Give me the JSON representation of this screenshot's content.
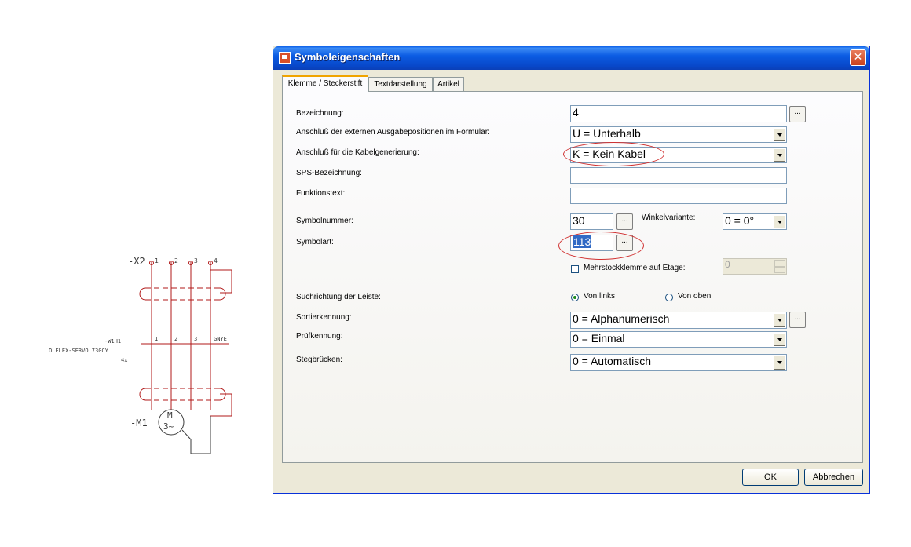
{
  "schematic": {
    "terminal_strip": "-X2",
    "pins_top": [
      "1",
      "2",
      "3",
      "4"
    ],
    "pins_cable": [
      "1",
      "2",
      "3",
      "GNYE"
    ],
    "cable_name": "-W1H1",
    "cable_type": "OLFLEX-SERVO 730CY",
    "cable_cores": "4x",
    "motor_ref": "-M1",
    "motor_symbol": "M",
    "motor_phase": "3~"
  },
  "dialog": {
    "title": "Symboleigenschaften",
    "close": "✕",
    "tabs": [
      "Klemme / Steckerstift",
      "Textdarstellung",
      "Artikel"
    ],
    "labels": {
      "bezeichnung": "Bezeichnung:",
      "anschluss_extern": "Anschluß der externen Ausgabepositionen im Formular:",
      "anschluss_kabel": "Anschluß für die Kabelgenerierung:",
      "sps": "SPS-Bezeichnung:",
      "funktionstext": "Funktionstext:",
      "symbolnummer": "Symbolnummer:",
      "winkelvariante": "Winkelvariante:",
      "symbolart": "Symbolart:",
      "mehrstock": "Mehrstockklemme auf Etage:",
      "suchrichtung": "Suchrichtung der Leiste:",
      "von_links": "Von links",
      "von_oben": "Von oben",
      "sortierkennung": "Sortierkennung:",
      "pruefkennung": "Prüfkennung:",
      "stegbruecken": "Stegbrücken:"
    },
    "values": {
      "bezeichnung": "4",
      "anschluss_extern": "U = Unterhalb",
      "anschluss_kabel": "K = Kein Kabel",
      "sps": "",
      "funktionstext": "",
      "symbolnummer": "30",
      "winkelvariante": "0 = 0°",
      "symbolart": "113",
      "mehrstock_etage": "0",
      "sortierkennung": "0 = Alphanumerisch",
      "pruefkennung": "0 = Einmal",
      "stegbruecken": "0 = Automatisch"
    },
    "ellipsis": "...",
    "ok": "OK",
    "cancel": "Abbrechen"
  }
}
